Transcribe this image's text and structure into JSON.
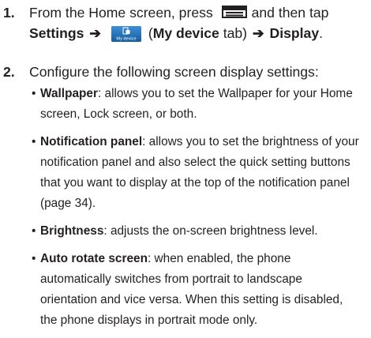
{
  "step1": {
    "number": "1.",
    "text_before_icon": "From the Home screen, press",
    "text_after_icon": "and then tap",
    "settings": "Settings",
    "arrow1": "➔",
    "mydevice_icon_label": "My device",
    "paren_open": "(",
    "mydevice_tab": "My device",
    "tab_word": "tab)",
    "arrow2": "➔",
    "display": "Display",
    "period": "."
  },
  "step2": {
    "number": "2.",
    "text": "Configure the following screen display settings:"
  },
  "bullets": [
    {
      "bullet": "•",
      "term": "Wallpaper",
      "description": ": allows you to set the Wallpaper for your Home screen, Lock screen, or both."
    },
    {
      "bullet": "•",
      "term": "Notification panel",
      "description": ": allows you to set the brightness of your notification panel and also select the quick setting buttons that you want to display at the top of the notification panel (page 34)."
    },
    {
      "bullet": "•",
      "term": "Brightness",
      "description": ": adjusts the on-screen brightness level."
    },
    {
      "bullet": "•",
      "term": "Auto rotate screen",
      "description": ": when enabled, the phone automatically switches from portrait to landscape orientation and vice versa. When this setting is disabled, the phone displays in portrait mode only."
    }
  ],
  "icons": [
    "menu-icon",
    "my-device-tab-icon"
  ],
  "colors": {
    "text": "#231f20",
    "icon_blue": "#1f6fb5"
  }
}
